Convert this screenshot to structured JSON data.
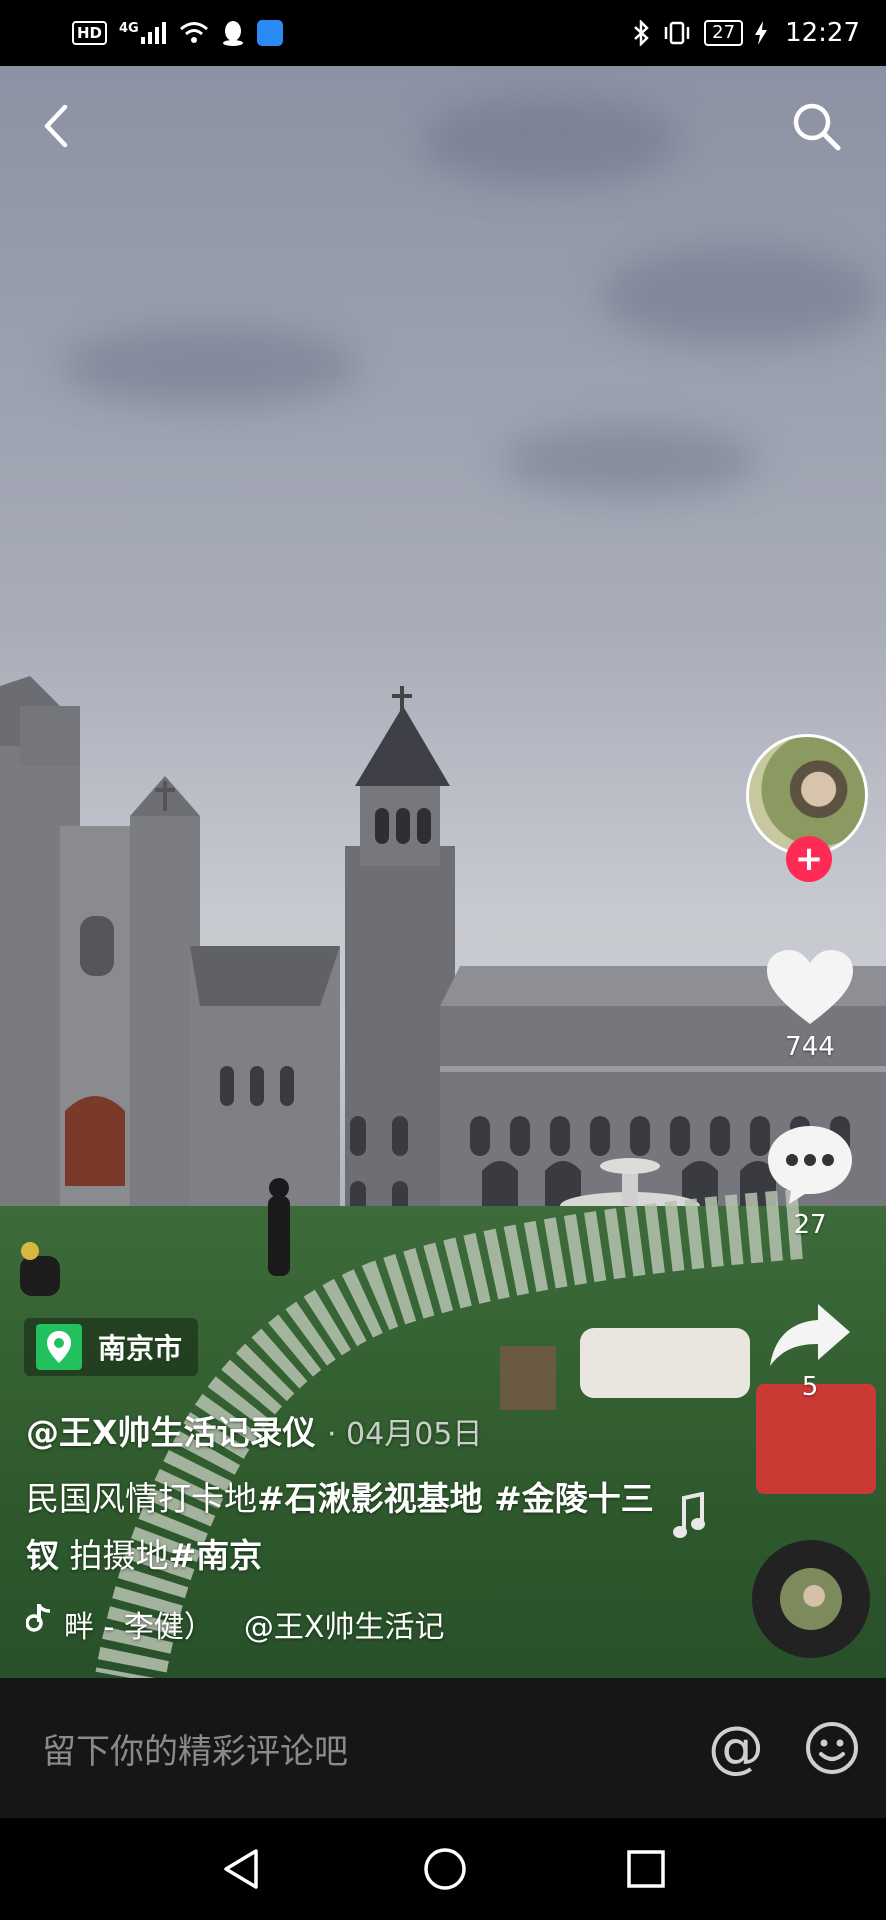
{
  "status_bar": {
    "hd": "HD",
    "network": "4G",
    "battery": "27",
    "time": "12:27"
  },
  "video": {
    "location": "南京市",
    "author": "@王X帅生活记录仪",
    "date": "· 04月05日",
    "caption_text_1": "民国风情打卡地",
    "caption_tag_1": "#石湫影视基地 #金陵十三钗",
    "caption_text_2": " 拍摄地",
    "caption_tag_2": "#南京",
    "music": "畔 - 李健）",
    "music_author": "@王X帅生活记"
  },
  "actions": {
    "likes": "744",
    "comments": "27",
    "shares": "5",
    "follow_symbol": "+"
  },
  "comment_bar": {
    "placeholder": "留下你的精彩评论吧",
    "at_symbol": "@"
  },
  "colors": {
    "follow": "#fe2c55",
    "location_pin": "#22c15e"
  }
}
